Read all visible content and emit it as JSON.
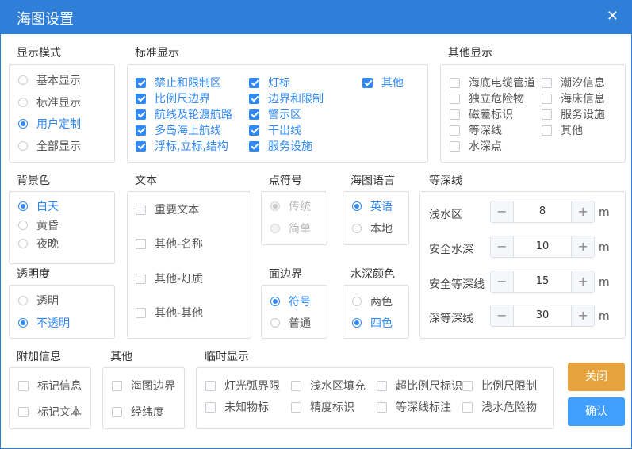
{
  "window": {
    "title": "海图设置",
    "close_icon": "close-icon"
  },
  "display_mode": {
    "title": "显示模式",
    "options": [
      "基本显示",
      "标准显示",
      "用户定制",
      "全部显示"
    ],
    "selected": "用户定制"
  },
  "standard_display": {
    "title": "标准显示",
    "col1": [
      "禁止和限制区",
      "比例尺边界",
      "航线及轮渡航路",
      "多岛海上航线",
      "浮标,立标,结构"
    ],
    "col2": [
      "灯标",
      "边界和限制",
      "警示区",
      "干出线",
      "服务设施"
    ],
    "col3": [
      "其他"
    ],
    "all_checked": true
  },
  "other_display": {
    "title": "其他显示",
    "col1": [
      "海底电缆管道",
      "独立危险物",
      "磁差标识",
      "等深线",
      "水深点"
    ],
    "col2": [
      "潮汐信息",
      "海床信息",
      "服务设施",
      "其他"
    ]
  },
  "background": {
    "title": "背景色",
    "options": [
      "白天",
      "黄昏",
      "夜晚"
    ],
    "selected": "白天"
  },
  "text": {
    "title": "文本",
    "options": [
      "重要文本",
      "其他-名称",
      "其他-灯质",
      "其他-其他"
    ]
  },
  "point_symbol": {
    "title": "点符号",
    "options": [
      "传统",
      "简单"
    ],
    "selected": "传统",
    "disabled": true
  },
  "chart_language": {
    "title": "海图语言",
    "options": [
      "英语",
      "本地"
    ],
    "selected": "英语"
  },
  "depth_contour": {
    "title": "等深线",
    "unit": "m",
    "rows": [
      {
        "label": "浅水区",
        "value": "8"
      },
      {
        "label": "安全水深",
        "value": "10"
      },
      {
        "label": "安全等深线",
        "value": "15"
      },
      {
        "label": "深等深线",
        "value": "30"
      }
    ],
    "minus": "−",
    "plus": "+"
  },
  "transparency": {
    "title": "透明度",
    "options": [
      "透明",
      "不透明"
    ],
    "selected": "不透明"
  },
  "area_boundary": {
    "title": "面边界",
    "options": [
      "符号",
      "普通"
    ],
    "selected": "符号"
  },
  "water_color": {
    "title": "水深颜色",
    "options": [
      "两色",
      "四色"
    ],
    "selected": "四色"
  },
  "extra_info": {
    "title": "附加信息",
    "options": [
      "标记信息",
      "标记文本"
    ]
  },
  "other": {
    "title": "其他",
    "options": [
      "海图边界",
      "经纬度"
    ]
  },
  "temp_display": {
    "title": "临时显示",
    "row1": [
      "灯光弧界限",
      "浅水区填充",
      "超比例尺标识",
      "比例尺限制"
    ],
    "row2": [
      "未知物标",
      "精度标识",
      "等深线标注",
      "浅水危险物"
    ]
  },
  "buttons": {
    "close": "关闭",
    "confirm": "确认"
  },
  "colors": {
    "title_bar": "#2f7fd8",
    "accent": "#2f8af5",
    "close_button": "#e6a23c",
    "confirm_button": "#409eff"
  }
}
